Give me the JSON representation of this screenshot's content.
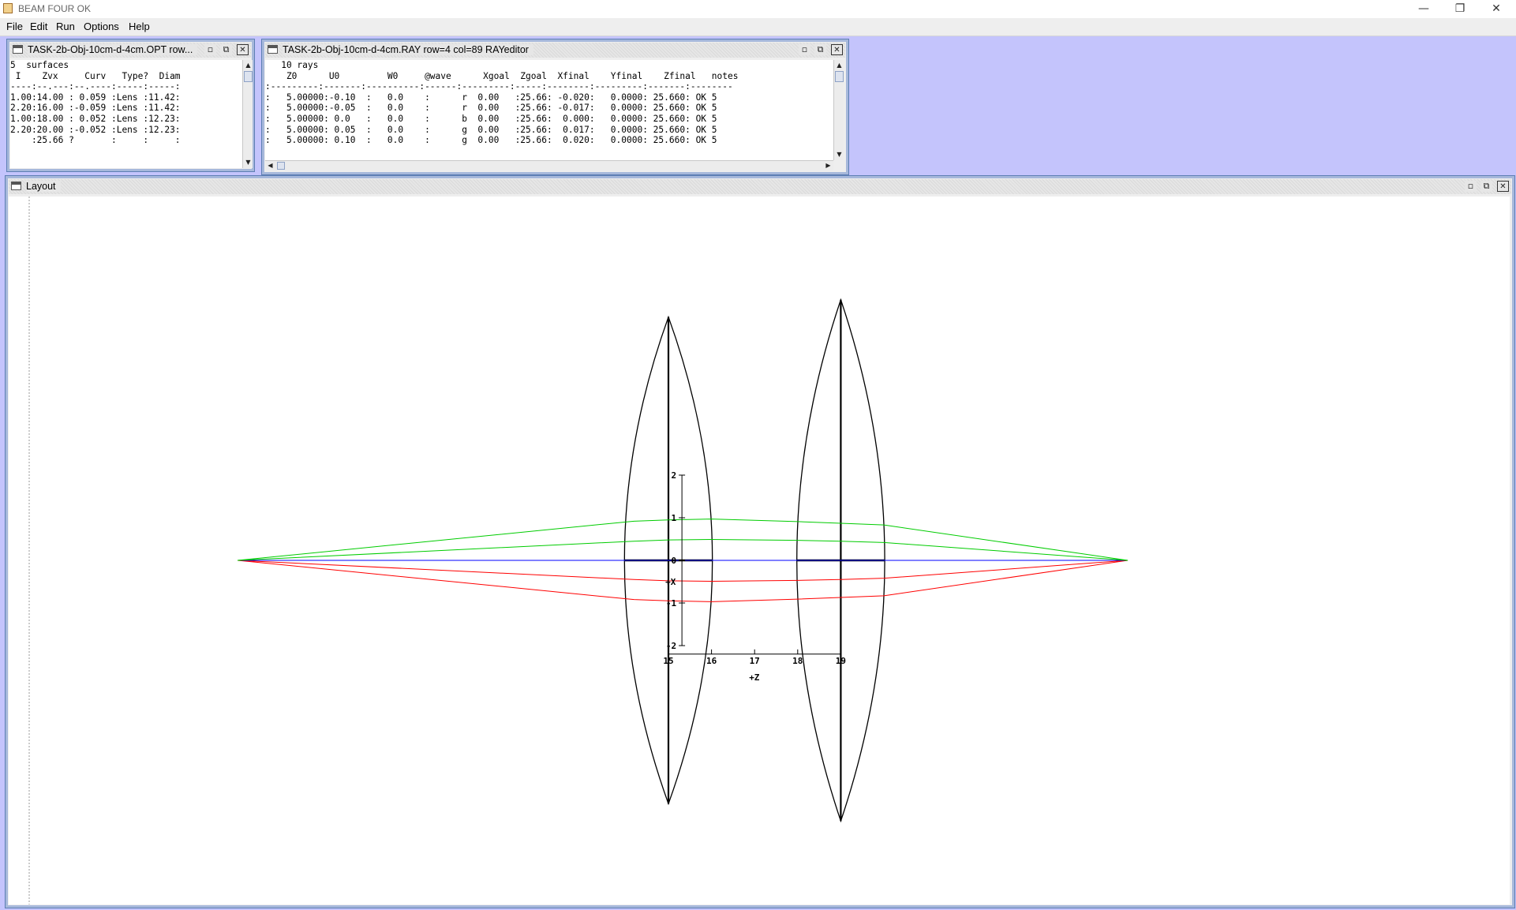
{
  "app": {
    "title": "BEAM FOUR  OK"
  },
  "window_controls": [
    "—",
    "❐",
    "✕"
  ],
  "menubar": {
    "items": [
      "File",
      "Edit",
      "Run",
      "Options",
      "Help"
    ]
  },
  "opt_window": {
    "title": "TASK-2b-Obj-10cm-d-4cm.OPT  row...",
    "lines": [
      "5  surfaces",
      " I    Zvx     Curv   Type?  Diam",
      "----:--.---:--.----:-----:-----:",
      "1.00:14.00 : 0.059 :Lens :11.42:",
      "2.20:16.00 :-0.059 :Lens :11.42:",
      "1.00:18.00 : 0.052 :Lens :12.23:",
      "2.20:20.00 :-0.052 :Lens :12.23:",
      "    :25.66 ?       :     :     :"
    ]
  },
  "ray_window": {
    "title": "TASK-2b-Obj-10cm-d-4cm.RAY  row=4  col=89     RAYeditor",
    "lines": [
      "   10 rays",
      "    Z0      U0         W0     @wave      Xgoal  Zgoal  Xfinal    Yfinal    Zfinal   notes",
      ":---------:-------:----------:------:---------:-----:--------:---------:-------:--------",
      ":   5.00000:-0.10  :   0.0    :      r  0.00   :25.66: -0.020:   0.0000: 25.660: OK 5",
      ":   5.00000:-0.05  :   0.0    :      r  0.00   :25.66: -0.017:   0.0000: 25.660: OK 5",
      ":   5.00000: 0.0   :   0.0    :      b  0.00   :25.66:  0.000:   0.0000: 25.660: OK 5",
      ":   5.00000: 0.05  :   0.0    :      g  0.00   :25.66:  0.017:   0.0000: 25.660: OK 5",
      ":   5.00000: 0.10  :   0.0    :      g  0.00   :25.66:  0.020:   0.0000: 25.660: OK 5"
    ]
  },
  "layout_window": {
    "title": "Layout",
    "axes": {
      "x_axis_label": "+X",
      "z_axis_label": "+Z",
      "x_ticks": [
        "2",
        "1",
        "0",
        "-1",
        "-2"
      ],
      "z_ticks": [
        "15",
        "16",
        "17",
        "18",
        "19"
      ]
    },
    "lenses": [
      {
        "z_front": 14.0,
        "z_back": 16.0,
        "diam": 11.42
      },
      {
        "z_front": 18.0,
        "z_back": 20.0,
        "diam": 12.23
      }
    ],
    "rays": [
      {
        "wave": "r",
        "color": "#ff0000",
        "z": [
          5.0,
          14.2,
          15.0,
          16.0,
          18.0,
          19.0,
          20.0,
          25.66
        ],
        "x": [
          0.0,
          -0.45,
          -0.48,
          -0.49,
          -0.47,
          -0.45,
          -0.42,
          0.0
        ]
      },
      {
        "wave": "r",
        "color": "#ff0000",
        "z": [
          5.0,
          14.2,
          15.0,
          16.0,
          18.0,
          19.0,
          20.0,
          25.66
        ],
        "x": [
          0.0,
          -0.92,
          -0.95,
          -0.97,
          -0.91,
          -0.87,
          -0.83,
          0.0
        ]
      },
      {
        "wave": "b",
        "color": "#0000ff",
        "z": [
          5.0,
          25.66
        ],
        "x": [
          0.0,
          0.0
        ]
      },
      {
        "wave": "g",
        "color": "#00cc00",
        "z": [
          5.0,
          14.2,
          15.0,
          16.0,
          18.0,
          19.0,
          20.0,
          25.66
        ],
        "x": [
          0.0,
          0.45,
          0.48,
          0.49,
          0.47,
          0.45,
          0.42,
          0.0
        ]
      },
      {
        "wave": "g",
        "color": "#00cc00",
        "z": [
          5.0,
          14.2,
          15.0,
          16.0,
          18.0,
          19.0,
          20.0,
          25.66
        ],
        "x": [
          0.0,
          0.92,
          0.95,
          0.97,
          0.91,
          0.87,
          0.83,
          0.0
        ]
      }
    ]
  }
}
